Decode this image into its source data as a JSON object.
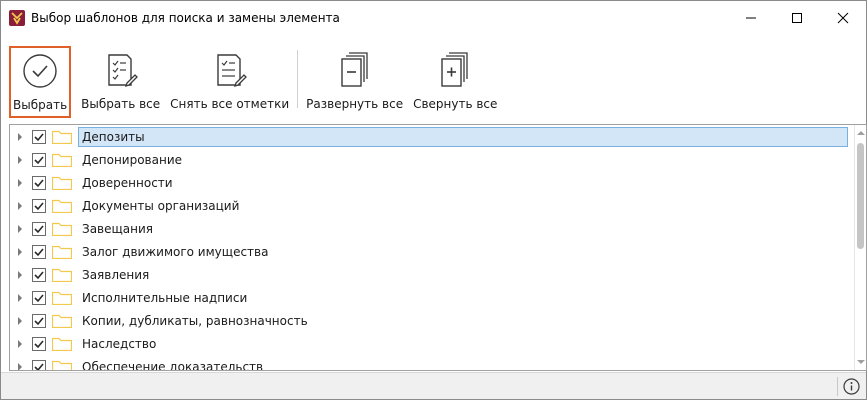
{
  "window": {
    "title": "Выбор шаблонов для поиска и замены элемента",
    "icon": "app-logo-icon",
    "controls": [
      "minimize-icon",
      "maximize-icon",
      "close-icon"
    ]
  },
  "toolbar": {
    "select_label": "Выбрать",
    "select_all_label": "Выбрать все",
    "unselect_all_label": "Снять все отметки",
    "expand_all_label": "Развернуть все",
    "collapse_all_label": "Свернуть все",
    "active_color": "#e0602a"
  },
  "tree": {
    "items": [
      {
        "label": "Депозиты",
        "checked": true,
        "selected": true
      },
      {
        "label": "Депонирование",
        "checked": true,
        "selected": false
      },
      {
        "label": "Доверенности",
        "checked": true,
        "selected": false
      },
      {
        "label": "Документы организаций",
        "checked": true,
        "selected": false
      },
      {
        "label": "Завещания",
        "checked": true,
        "selected": false
      },
      {
        "label": "Залог движимого имущества",
        "checked": true,
        "selected": false
      },
      {
        "label": "Заявления",
        "checked": true,
        "selected": false
      },
      {
        "label": "Исполнительные надписи",
        "checked": true,
        "selected": false
      },
      {
        "label": "Копии, дубликаты, равнозначность",
        "checked": true,
        "selected": false
      },
      {
        "label": "Наследство",
        "checked": true,
        "selected": false
      },
      {
        "label": "Обеспечение доказательств",
        "checked": true,
        "selected": false
      }
    ],
    "folder_color": "#f2c94c",
    "selection_color": "#d3e6f7"
  },
  "statusbar": {
    "icon": "info-icon"
  }
}
